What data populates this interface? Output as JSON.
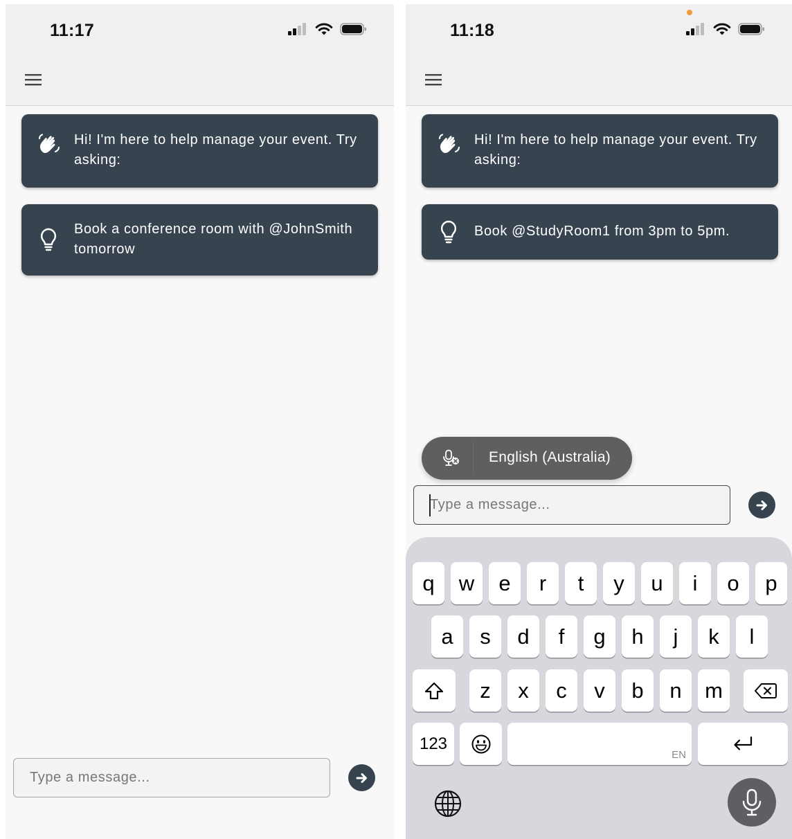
{
  "left": {
    "status": {
      "time": "11:17"
    },
    "greeting": {
      "text": "Hi! I'm here to help manage your event. Try asking:"
    },
    "suggestion": {
      "text": "Book a conference room with @JohnSmith tomorrow"
    },
    "input": {
      "placeholder": "Type a message..."
    }
  },
  "right": {
    "status": {
      "time": "11:18"
    },
    "greeting": {
      "text": "Hi! I'm here to help manage your event. Try asking:"
    },
    "suggestion": {
      "text": "Book @StudyRoom1 from 3pm to 5pm."
    },
    "dictation": {
      "language": "English (Australia)"
    },
    "input": {
      "placeholder": "Type a message..."
    },
    "keyboard": {
      "row1": [
        "q",
        "w",
        "e",
        "r",
        "t",
        "y",
        "u",
        "i",
        "o",
        "p"
      ],
      "row2": [
        "a",
        "s",
        "d",
        "f",
        "g",
        "h",
        "j",
        "k",
        "l"
      ],
      "row3": [
        "z",
        "x",
        "c",
        "v",
        "b",
        "n",
        "m"
      ],
      "numbers_label": "123",
      "space_hint": "EN"
    }
  },
  "colors": {
    "bubble": "#374450",
    "app_bar": "#f0f0f2",
    "page": "#f8f8f9",
    "keyboard": "#d7d8dd",
    "dictation_pill": "#5f5f5f"
  },
  "icons": [
    "menu-icon",
    "wave-hand-icon",
    "lightbulb-icon",
    "send-arrow-icon",
    "mic-off-icon",
    "shift-icon",
    "backspace-icon",
    "emoji-icon",
    "return-icon",
    "globe-icon",
    "microphone-icon",
    "signal-icon",
    "wifi-icon",
    "battery-icon"
  ]
}
